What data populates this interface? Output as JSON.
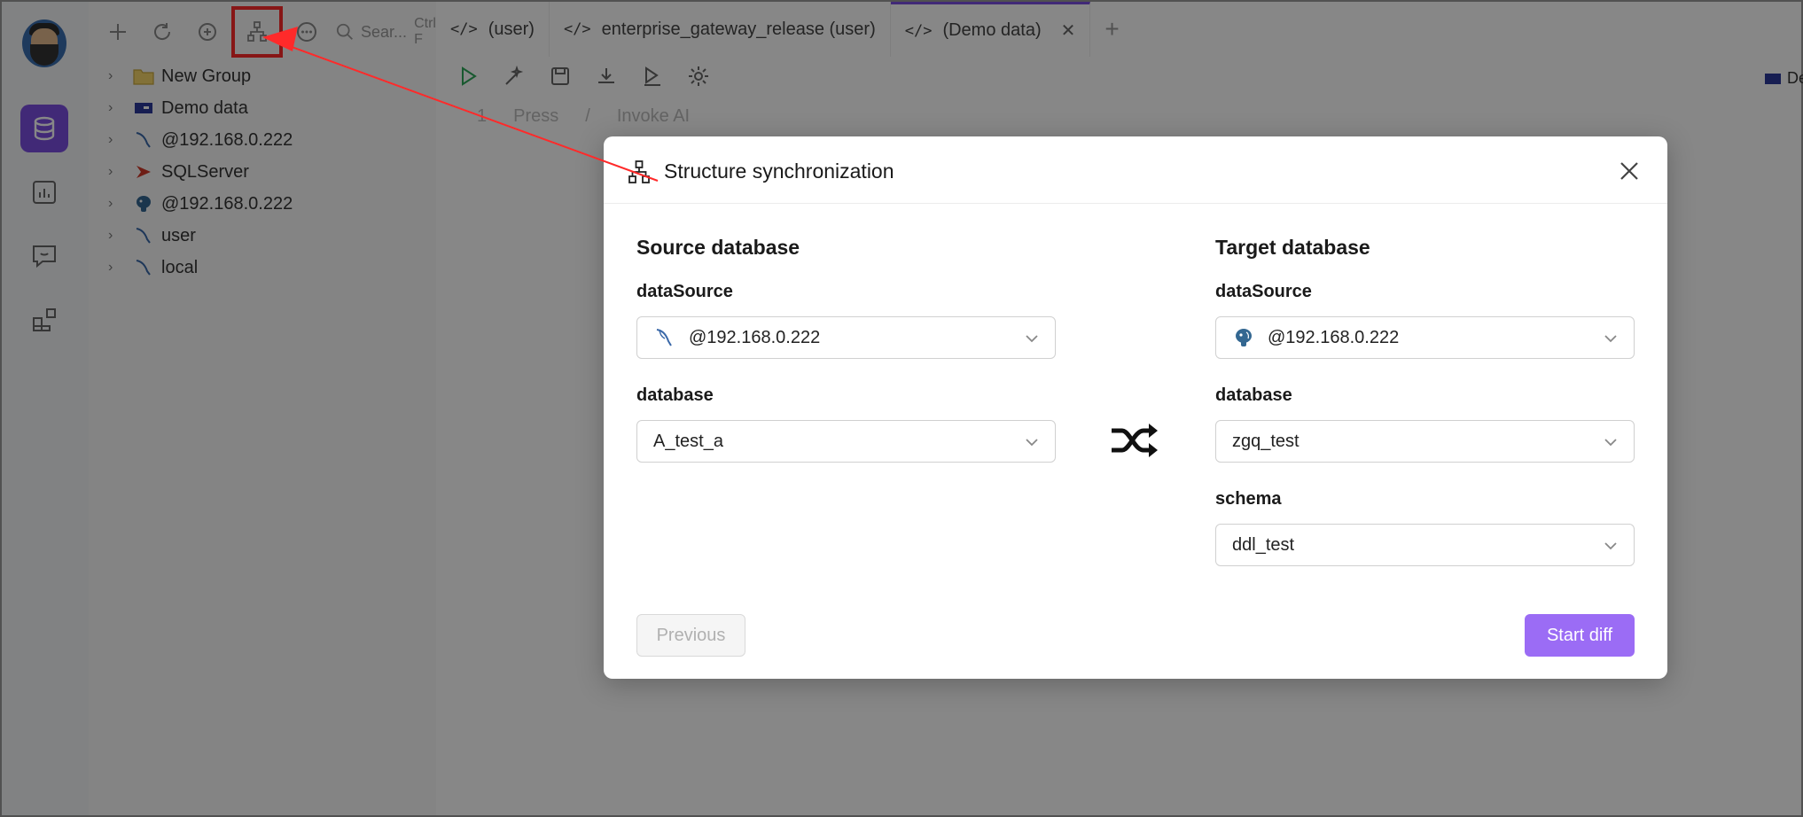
{
  "sidebar": {
    "search_placeholder": "Sear...",
    "search_shortcut": "Ctrl F",
    "tree": [
      {
        "label": "New Group",
        "icon": "folder-icon"
      },
      {
        "label": "Demo data",
        "icon": "demo-db-icon"
      },
      {
        "label": "@192.168.0.222",
        "icon": "mysql-icon"
      },
      {
        "label": "SQLServer",
        "icon": "sqlserver-icon"
      },
      {
        "label": "@192.168.0.222",
        "icon": "postgresql-icon"
      },
      {
        "label": "user",
        "icon": "mysql-icon"
      },
      {
        "label": "local",
        "icon": "mysql-icon"
      }
    ]
  },
  "tabs": [
    {
      "code": "</>",
      "label": "(user)"
    },
    {
      "code": "</>",
      "label": "enterprise_gateway_release (user)"
    },
    {
      "code": "</>",
      "label": "(Demo data)",
      "active": true
    }
  ],
  "editor": {
    "line_number": "1",
    "hint_press": "Press",
    "hint_sep": "/",
    "hint_ai": "Invoke AI"
  },
  "right_edge_text": "De",
  "modal": {
    "title": "Structure synchronization",
    "source": {
      "heading": "Source database",
      "datasource_label": "dataSource",
      "datasource_value": "@192.168.0.222",
      "database_label": "database",
      "database_value": "A_test_a"
    },
    "target": {
      "heading": "Target database",
      "datasource_label": "dataSource",
      "datasource_value": "@192.168.0.222",
      "database_label": "database",
      "database_value": "zgq_test",
      "schema_label": "schema",
      "schema_value": "ddl_test"
    },
    "previous_label": "Previous",
    "start_label": "Start diff"
  },
  "colors": {
    "accent": "#7b4fe0",
    "primary_button": "#9b6cf5",
    "annotation": "#ff2a2a"
  }
}
